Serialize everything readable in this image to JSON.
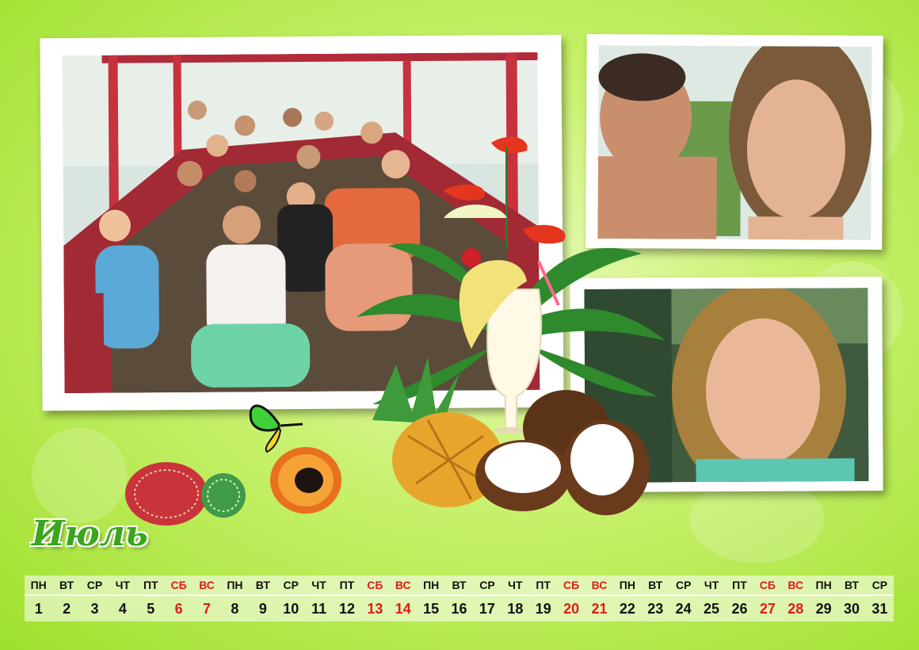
{
  "month_title": "Июль",
  "weekdays": [
    "ПН",
    "ВТ",
    "СР",
    "ЧТ",
    "ПТ",
    "СБ",
    "ВС",
    "ПН",
    "ВТ",
    "СР",
    "ЧТ",
    "ПТ",
    "СБ",
    "ВС",
    "ПН",
    "ВТ",
    "СР",
    "ЧТ",
    "ПТ",
    "СБ",
    "ВС",
    "ПН",
    "ВТ",
    "СР",
    "ЧТ",
    "ПТ",
    "СБ",
    "ВС",
    "ПН",
    "ВТ",
    "СР"
  ],
  "days": [
    "1",
    "2",
    "3",
    "4",
    "5",
    "6",
    "7",
    "8",
    "9",
    "10",
    "11",
    "12",
    "13",
    "14",
    "15",
    "16",
    "17",
    "18",
    "19",
    "20",
    "21",
    "22",
    "23",
    "24",
    "25",
    "26",
    "27",
    "28",
    "29",
    "30",
    "31"
  ],
  "weekend_indices": [
    5,
    6,
    12,
    13,
    19,
    20,
    26,
    27
  ],
  "colors": {
    "weekend": "#e01b1b",
    "month_title": "#3aa51d",
    "background": "#b6ea4f"
  },
  "photos": [
    {
      "name": "group-boat-photo"
    },
    {
      "name": "couple-selfie-photo"
    },
    {
      "name": "woman-wink-photo"
    }
  ],
  "decorations": [
    "tropical-cocktail-icon",
    "palm-leaves-icon",
    "pineapple-icon",
    "coconut-icon",
    "papaya-icon",
    "sea-urchin-icon",
    "butterfly-icon",
    "anthurium-flower-icon"
  ]
}
